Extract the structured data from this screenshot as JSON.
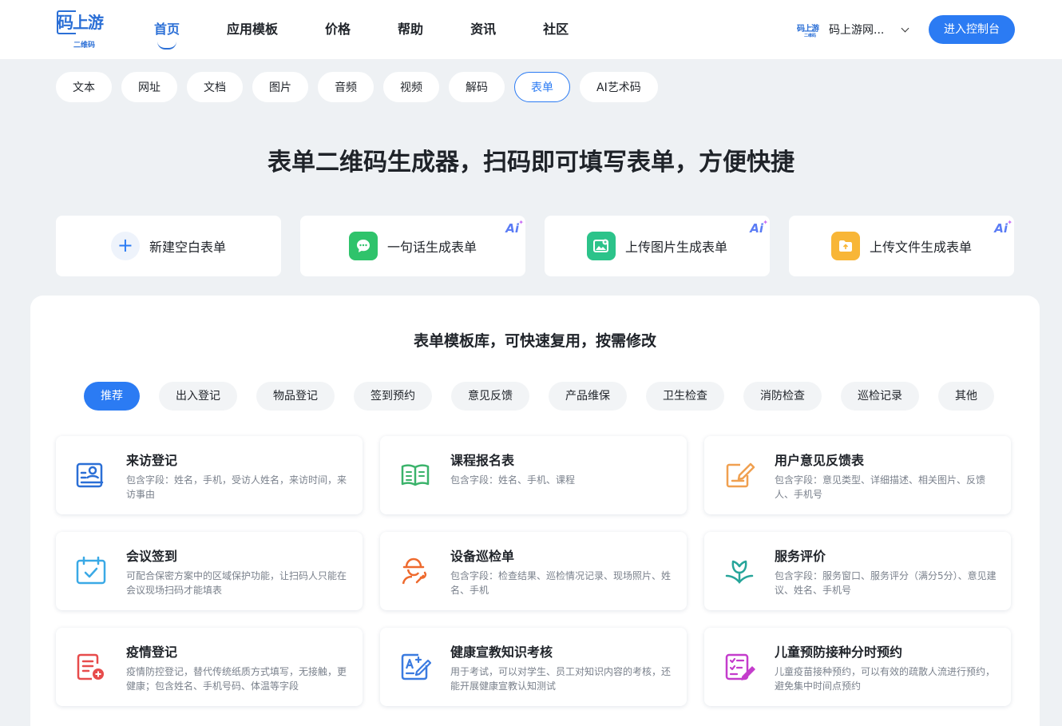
{
  "brand": {
    "logo_main": "码上游",
    "logo_sub": "二维码"
  },
  "nav": [
    {
      "label": "首页",
      "active": true
    },
    {
      "label": "应用模板"
    },
    {
      "label": "价格"
    },
    {
      "label": "帮助"
    },
    {
      "label": "资讯"
    },
    {
      "label": "社区"
    }
  ],
  "user": {
    "logo_main": "码上游",
    "logo_sub": "二维码",
    "name": "码上游网...",
    "icon": "chevron-down-icon"
  },
  "console_button": "进入控制台",
  "categories": [
    {
      "label": "文本"
    },
    {
      "label": "网址"
    },
    {
      "label": "文档"
    },
    {
      "label": "图片"
    },
    {
      "label": "音频"
    },
    {
      "label": "视频"
    },
    {
      "label": "解码"
    },
    {
      "label": "表单",
      "active": true
    },
    {
      "label": "AI艺术码"
    }
  ],
  "hero_title": "表单二维码生成器，扫码即可填写表单，方便快捷",
  "actions": [
    {
      "label": "新建空白表单",
      "icon": "plus-icon"
    },
    {
      "label": "一句话生成表单",
      "icon": "chat-bubble-icon",
      "color": "#2fc36b",
      "badge": "Ai"
    },
    {
      "label": "上传图片生成表单",
      "icon": "image-upload-icon",
      "color": "#2cc38a",
      "badge": "Ai"
    },
    {
      "label": "上传文件生成表单",
      "icon": "folder-upload-icon",
      "color": "#f8b637",
      "badge": "Ai"
    }
  ],
  "template_title": "表单模板库，可快速复用，按需修改",
  "template_tabs": [
    {
      "label": "推荐",
      "active": true
    },
    {
      "label": "出入登记"
    },
    {
      "label": "物品登记"
    },
    {
      "label": "签到预约"
    },
    {
      "label": "意见反馈"
    },
    {
      "label": "产品维保"
    },
    {
      "label": "卫生检查"
    },
    {
      "label": "消防检查"
    },
    {
      "label": "巡检记录"
    },
    {
      "label": "其他"
    }
  ],
  "templates": [
    {
      "title": "来访登记",
      "desc": "包含字段：姓名，手机，受访人姓名，来访时间，来访事由",
      "icon": "visitor-card-icon",
      "color": "#2b6fd6"
    },
    {
      "title": "课程报名表",
      "desc": "包含字段：姓名、手机、课程",
      "icon": "open-book-icon",
      "color": "#3bb36b"
    },
    {
      "title": "用户意见反馈表",
      "desc": "包含字段：意见类型、详细描述、相关图片、反馈人、手机号",
      "icon": "edit-note-icon",
      "color": "#f0a050"
    },
    {
      "title": "会议签到",
      "desc": "可配合保密方案中的区域保护功能，让扫码人只能在会议现场扫码才能填表",
      "icon": "calendar-check-icon",
      "color": "#3aa9e6"
    },
    {
      "title": "设备巡检单",
      "desc": "包含字段：检查结果、巡检情况记录、现场照片、姓名、手机",
      "icon": "worker-wrench-icon",
      "color": "#ee6a2e"
    },
    {
      "title": "服务评价",
      "desc": "包含字段：服务窗口、服务评分（满分5分）、意见建议、姓名、手机号",
      "icon": "flower-icon",
      "color": "#27a59a"
    },
    {
      "title": "疫情登记",
      "desc": "疫情防控登记，替代传统纸质方式填写，无接触，更健康；包含姓名、手机号码、体温等字段",
      "icon": "document-plus-icon",
      "color": "#e74c4c"
    },
    {
      "title": "健康宣教知识考核",
      "desc": "用于考试，可以对学生、员工对知识内容的考核，还能开展健康宣教认知测试",
      "icon": "exam-edit-icon",
      "color": "#3b7be0"
    },
    {
      "title": "儿童预防接种分时预约",
      "desc": "儿童疫苗接种预约，可以有效的疏散人流进行预约，避免集中时间点预约",
      "icon": "checklist-pen-icon",
      "color": "#c43ccc"
    }
  ]
}
